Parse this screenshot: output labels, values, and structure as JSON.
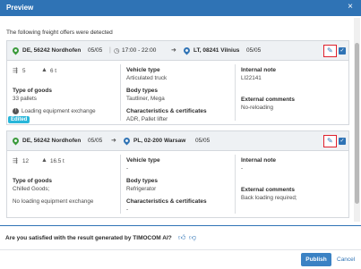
{
  "window": {
    "title": "Preview",
    "close_glyph": "×"
  },
  "intro": "The following freight offers were detected",
  "offers": [
    {
      "from": "DE, 56242 Nordhofen",
      "from_date": "05/05",
      "time": "17:00 - 22:00",
      "to": "LT, 08241 Vilnius",
      "to_date": "05/05",
      "loading_meters": "5",
      "weight": "6 t",
      "type_of_goods_label": "Type of goods",
      "type_of_goods": "33 pallets",
      "loading_note": "Loading equipment exchange",
      "badge": "Edited",
      "vehicle_type_label": "Vehicle type",
      "vehicle_type": "Articulated truck",
      "body_types_label": "Body types",
      "body_types": "Tautliner, Mega",
      "char_label": "Characteristics & certificates",
      "char": "ADR, Pallet lifter",
      "internal_note_label": "Internal note",
      "internal_note": "LI22141",
      "external_label": "External comments",
      "external": "No-reloading"
    },
    {
      "from": "DE, 56242 Nordhofen",
      "from_date": "05/05",
      "to": "PL, 02-200 Warsaw",
      "to_date": "05/05",
      "loading_meters": "12",
      "weight": "16.5 t",
      "type_of_goods_label": "Type of goods",
      "type_of_goods": "Chilled Goods;",
      "loading_note": "No loading equipment exchange",
      "vehicle_type_label": "Vehicle type",
      "vehicle_type": "-",
      "body_types_label": "Body types",
      "body_types": "Refrigerator",
      "char_label": "Characteristics & certificates",
      "char": "-",
      "internal_note_label": "Internal note",
      "internal_note": "-",
      "external_label": "External comments",
      "external": "Back loading required;"
    }
  ],
  "feedback": {
    "question": "Are you satisfied with the result generated by TIMOCOM AI?"
  },
  "buttons": {
    "publish": "Publish",
    "cancel": "Cancel"
  },
  "colors": {
    "accent": "#2f73b5",
    "edited_badge": "#29b6d9",
    "highlight": "#e0202c"
  },
  "icons": [
    "close-icon",
    "location-pin-icon",
    "clock-icon",
    "truck-length-icon",
    "weight-icon",
    "pencil-icon",
    "checkbox-icon",
    "info-icon",
    "thumbs-up-icon",
    "thumbs-down-icon"
  ]
}
